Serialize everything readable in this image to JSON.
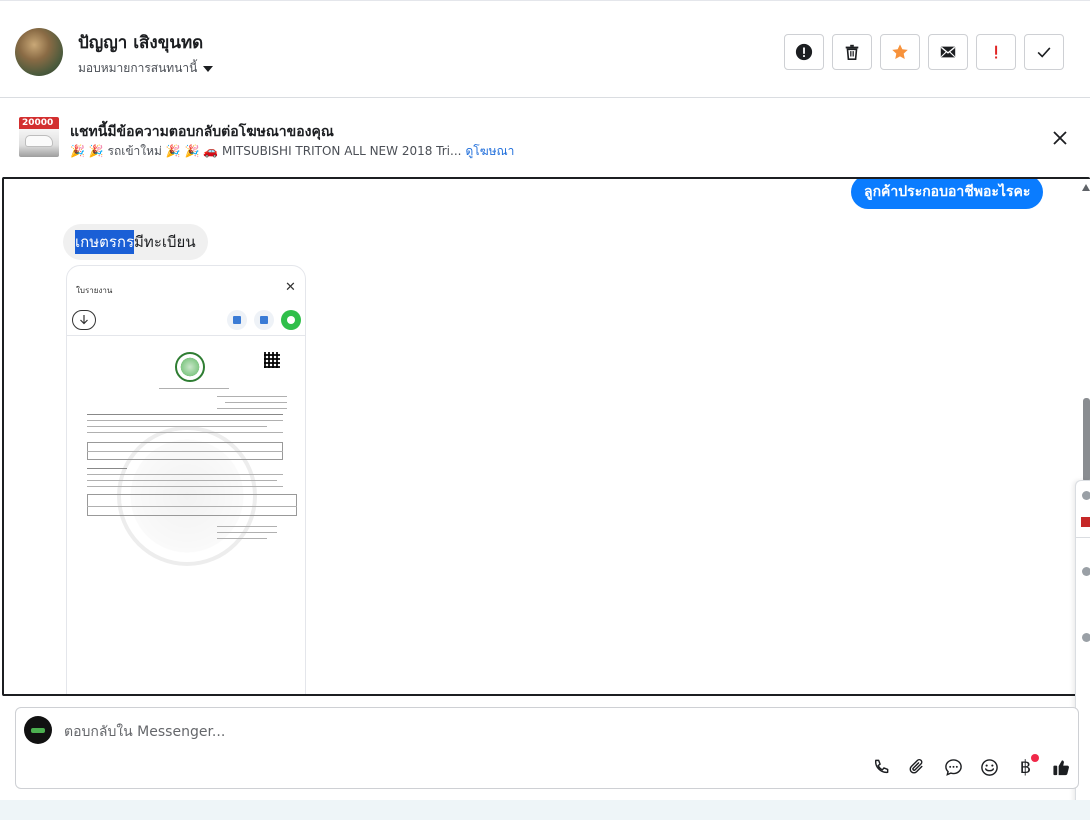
{
  "header": {
    "contact_name": "ปัญญา เสิงขุนทด",
    "assign_label": "มอบหมายการสนทนานี้",
    "actions": [
      "spam-icon",
      "trash-icon",
      "star-icon",
      "mail-icon",
      "important-icon",
      "done-icon"
    ],
    "colors": {
      "star": "#f7923b",
      "important": "#e02424"
    }
  },
  "ad_banner": {
    "title": "แชทนี้มีข้อความตอบกลับต่อโฆษณาของคุณ",
    "subtitle": "🎉 🎉 รถเข้าใหม่ 🎉 🎉 🚗 MITSUBISHI TRITON ALL NEW 2018 Tri...",
    "link": "ดูโฆษณา",
    "thumb_text": "20000"
  },
  "messages": {
    "outgoing_text": "ลูกค้าประกอบอาชีพอะไรคะ",
    "incoming_selected": "เกษตรกร",
    "incoming_rest": "มีทะเบียน",
    "image": {
      "header_title": "ใบรายงาน",
      "close_glyph": "✕"
    }
  },
  "composer": {
    "placeholder": "ตอบกลับใน Messenger...",
    "value": "",
    "tools": [
      "phone-icon",
      "attach-icon",
      "chat-bubble-icon",
      "emoji-icon",
      "payment-icon",
      "like-icon"
    ],
    "payment_glyph": "฿"
  },
  "colors": {
    "accent": "#0a7cff",
    "highlight": "#1a5fd6",
    "link": "#216fdb",
    "notify": "#f02849"
  }
}
